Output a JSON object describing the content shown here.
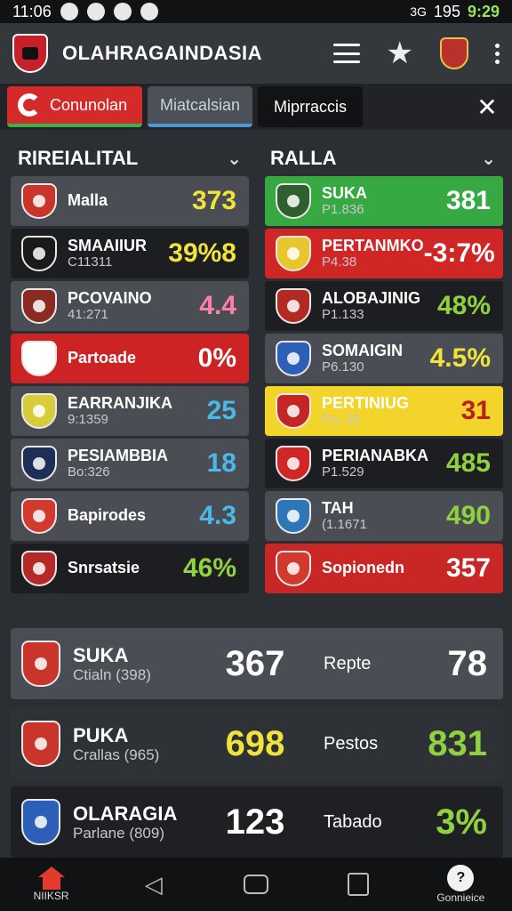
{
  "status": {
    "time_left": "11:06",
    "signal": "3G",
    "battery": "195",
    "time_right": "9:29"
  },
  "app": {
    "title": "OLAHRAGAINDASIA"
  },
  "tabs": [
    {
      "label": "Conunolan"
    },
    {
      "label": "Miatcalsian"
    },
    {
      "label": "Miprraccis"
    }
  ],
  "sections": {
    "left_title": "RIREIALITAL",
    "right_title": "RALLA"
  },
  "left_cards": [
    {
      "name": "Malla",
      "sub": "",
      "value": "373",
      "value_color": "#f0e43a",
      "bg": "#4a4e54",
      "crest": "#c9352b"
    },
    {
      "name": "SMAAIIUR",
      "sub": "C11311",
      "value": "39%8",
      "value_color": "#f0e43a",
      "bg": "#1d1e21",
      "crest": "#1a1a1a"
    },
    {
      "name": "PCOVAINO",
      "sub": "41:271",
      "value": "4.4",
      "value_color": "#ff7fa6",
      "bg": "#4a4e54",
      "crest": "#8a2a23"
    },
    {
      "name": "Partoade",
      "sub": "",
      "value": "0%",
      "value_color": "#ffffff",
      "bg": "#cc2424",
      "crest": "#ffffff"
    },
    {
      "name": "EARRANJIKA",
      "sub": "9:1359",
      "value": "25",
      "value_color": "#49b9ea",
      "bg": "#4a4e54",
      "crest": "#d8cc3a"
    },
    {
      "name": "PESIAMBBIA",
      "sub": "Bo:326",
      "value": "18",
      "value_color": "#49b9ea",
      "bg": "#4a4e54",
      "crest": "#1f2e57"
    },
    {
      "name": "Bapirodes",
      "sub": "",
      "value": "4.3",
      "value_color": "#49b9ea",
      "bg": "#4a4e54",
      "crest": "#d23a2d"
    },
    {
      "name": "Snrsatsie",
      "sub": "",
      "value": "46%",
      "value_color": "#8fd13f",
      "bg": "#1d1e21",
      "crest": "#b52929"
    }
  ],
  "right_cards": [
    {
      "name": "SUKA",
      "sub": "P1.836",
      "value": "381",
      "value_color": "#ffffff",
      "bg": "#37a943",
      "crest": "#2f5f2e"
    },
    {
      "name": "PERTANMKO",
      "sub": "P4.38",
      "value": "-3:7%",
      "value_color": "#ffffff",
      "bg": "#d02626",
      "crest": "#e8c62e"
    },
    {
      "name": "ALOBAJINIG",
      "sub": "P1.133",
      "value": "48%",
      "value_color": "#8fd13f",
      "bg": "#1d1e21",
      "crest": "#b22a22"
    },
    {
      "name": "SOMAIGIN",
      "sub": "P6.130",
      "value": "4.5%",
      "value_color": "#f0e43a",
      "bg": "#4a4e54",
      "crest": "#2b5fb8"
    },
    {
      "name": "PERTINIUG",
      "sub": "Po: 26",
      "value": "31",
      "value_color": "#b81f1f",
      "bg": "#f2d42a",
      "crest": "#c42626"
    },
    {
      "name": "PERIANABKA",
      "sub": "P1.529",
      "value": "485",
      "value_color": "#8fd13f",
      "bg": "#1d1e21",
      "crest": "#d02626"
    },
    {
      "name": "TAH",
      "sub": "(1.1671",
      "value": "490",
      "value_color": "#8fd13f",
      "bg": "#4a4e54",
      "crest": "#2d77b8"
    },
    {
      "name": "Sopionedn",
      "sub": "",
      "value": "357",
      "value_color": "#ffffff",
      "bg": "#c92626",
      "crest": "#d23a2d"
    }
  ],
  "wide_cards": [
    {
      "name": "SUKA",
      "sub": "Ctialn (398)",
      "value1": "367",
      "value1_color": "#ffffff",
      "label": "Repte",
      "value2": "78",
      "value2_color": "#ffffff",
      "bg": "#4a4e54",
      "crest": "#c9352b"
    },
    {
      "name": "PUKA",
      "sub": "Crallas (965)",
      "value1": "698",
      "value1_color": "#f0e43a",
      "label": "Pestos",
      "value2": "831",
      "value2_color": "#8fd13f",
      "bg": "#2e3236",
      "crest": "#c9352b"
    },
    {
      "name": "OLARAGIA",
      "sub": "Parlane (809)",
      "value1": "123",
      "value1_color": "#ffffff",
      "label": "Tabado",
      "value2": "3%",
      "value2_color": "#8fd13f",
      "bg": "#1e2023",
      "crest": "#2b5fb8"
    }
  ],
  "nav": {
    "home_label": "NIIKSR",
    "connect_label": "Gonnieice"
  }
}
